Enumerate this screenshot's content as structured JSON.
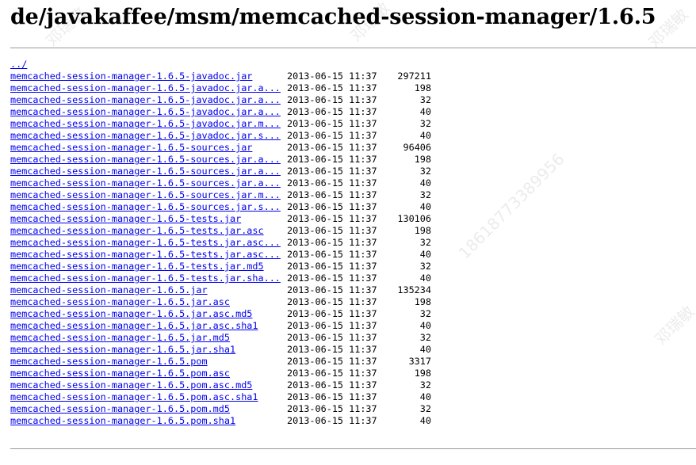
{
  "page": {
    "title": "de/javakaffee/msm/memcached-session-manager/1.6.5",
    "parent_link": "../"
  },
  "watermark": {
    "texts": [
      "邓瑞敏",
      "18618773389956",
      "邓瑞敏",
      "邓瑞敏",
      "邓瑞敏"
    ]
  },
  "files": [
    {
      "name": "memcached-session-manager-1.6.5-javadoc.jar",
      "date": "2013-06-15 11:37",
      "size": "297211"
    },
    {
      "name": "memcached-session-manager-1.6.5-javadoc.jar.a...",
      "date": "2013-06-15 11:37",
      "size": "198"
    },
    {
      "name": "memcached-session-manager-1.6.5-javadoc.jar.a...",
      "date": "2013-06-15 11:37",
      "size": "32"
    },
    {
      "name": "memcached-session-manager-1.6.5-javadoc.jar.a...",
      "date": "2013-06-15 11:37",
      "size": "40"
    },
    {
      "name": "memcached-session-manager-1.6.5-javadoc.jar.m...",
      "date": "2013-06-15 11:37",
      "size": "32"
    },
    {
      "name": "memcached-session-manager-1.6.5-javadoc.jar.s...",
      "date": "2013-06-15 11:37",
      "size": "40"
    },
    {
      "name": "memcached-session-manager-1.6.5-sources.jar",
      "date": "2013-06-15 11:37",
      "size": "96406"
    },
    {
      "name": "memcached-session-manager-1.6.5-sources.jar.a...",
      "date": "2013-06-15 11:37",
      "size": "198"
    },
    {
      "name": "memcached-session-manager-1.6.5-sources.jar.a...",
      "date": "2013-06-15 11:37",
      "size": "32"
    },
    {
      "name": "memcached-session-manager-1.6.5-sources.jar.a...",
      "date": "2013-06-15 11:37",
      "size": "40"
    },
    {
      "name": "memcached-session-manager-1.6.5-sources.jar.m...",
      "date": "2013-06-15 11:37",
      "size": "32"
    },
    {
      "name": "memcached-session-manager-1.6.5-sources.jar.s...",
      "date": "2013-06-15 11:37",
      "size": "40"
    },
    {
      "name": "memcached-session-manager-1.6.5-tests.jar",
      "date": "2013-06-15 11:37",
      "size": "130106"
    },
    {
      "name": "memcached-session-manager-1.6.5-tests.jar.asc",
      "date": "2013-06-15 11:37",
      "size": "198"
    },
    {
      "name": "memcached-session-manager-1.6.5-tests.jar.asc...",
      "date": "2013-06-15 11:37",
      "size": "32"
    },
    {
      "name": "memcached-session-manager-1.6.5-tests.jar.asc...",
      "date": "2013-06-15 11:37",
      "size": "40"
    },
    {
      "name": "memcached-session-manager-1.6.5-tests.jar.md5",
      "date": "2013-06-15 11:37",
      "size": "32"
    },
    {
      "name": "memcached-session-manager-1.6.5-tests.jar.sha...",
      "date": "2013-06-15 11:37",
      "size": "40"
    },
    {
      "name": "memcached-session-manager-1.6.5.jar",
      "date": "2013-06-15 11:37",
      "size": "135234"
    },
    {
      "name": "memcached-session-manager-1.6.5.jar.asc",
      "date": "2013-06-15 11:37",
      "size": "198"
    },
    {
      "name": "memcached-session-manager-1.6.5.jar.asc.md5",
      "date": "2013-06-15 11:37",
      "size": "32"
    },
    {
      "name": "memcached-session-manager-1.6.5.jar.asc.sha1",
      "date": "2013-06-15 11:37",
      "size": "40"
    },
    {
      "name": "memcached-session-manager-1.6.5.jar.md5",
      "date": "2013-06-15 11:37",
      "size": "32"
    },
    {
      "name": "memcached-session-manager-1.6.5.jar.sha1",
      "date": "2013-06-15 11:37",
      "size": "40"
    },
    {
      "name": "memcached-session-manager-1.6.5.pom",
      "date": "2013-06-15 11:37",
      "size": "3317"
    },
    {
      "name": "memcached-session-manager-1.6.5.pom.asc",
      "date": "2013-06-15 11:37",
      "size": "198"
    },
    {
      "name": "memcached-session-manager-1.6.5.pom.asc.md5",
      "date": "2013-06-15 11:37",
      "size": "32"
    },
    {
      "name": "memcached-session-manager-1.6.5.pom.asc.sha1",
      "date": "2013-06-15 11:37",
      "size": "40"
    },
    {
      "name": "memcached-session-manager-1.6.5.pom.md5",
      "date": "2013-06-15 11:37",
      "size": "32"
    },
    {
      "name": "memcached-session-manager-1.6.5.pom.sha1",
      "date": "2013-06-15 11:37",
      "size": "40"
    }
  ]
}
